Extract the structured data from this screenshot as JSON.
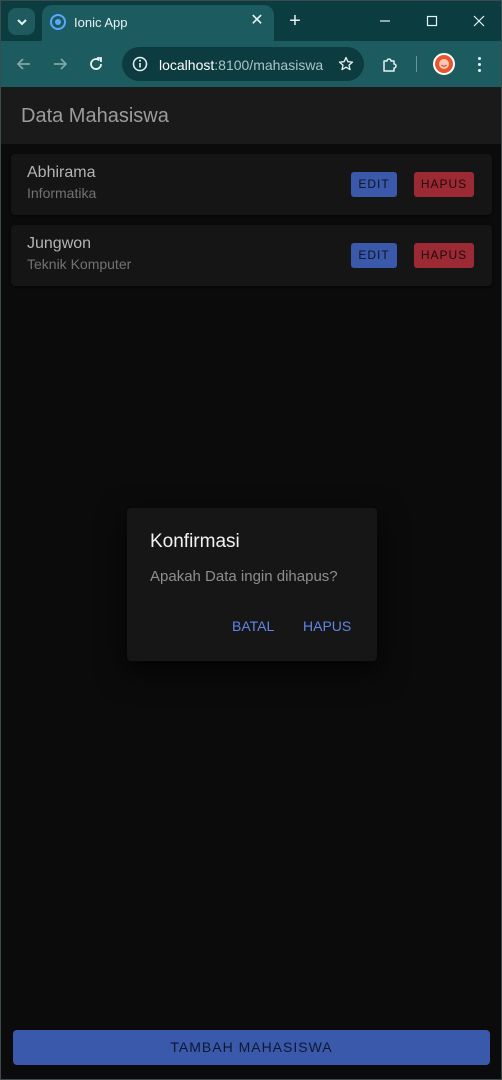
{
  "browser": {
    "tab_title": "Ionic App",
    "url_host": "localhost",
    "url_rest": ":8100/mahasiswa"
  },
  "app": {
    "title": "Data Mahasiswa",
    "students": [
      {
        "name": "Abhirama",
        "program": "Informatika",
        "edit_label": "EDIT",
        "delete_label": "HAPUS"
      },
      {
        "name": "Jungwon",
        "program": "Teknik Komputer",
        "edit_label": "EDIT",
        "delete_label": "HAPUS"
      }
    ],
    "add_label": "TAMBAH MAHASISWA"
  },
  "dialog": {
    "title": "Konfirmasi",
    "message": "Apakah Data ingin dihapus?",
    "cancel_label": "BATAL",
    "confirm_label": "HAPUS"
  },
  "colors": {
    "primary": "#3a59aa",
    "danger": "#9b2a35",
    "browser_frame": "#0b3d40"
  }
}
